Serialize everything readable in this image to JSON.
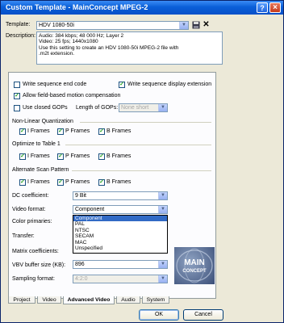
{
  "window": {
    "title": "Custom Template - MainConcept MPEG-2",
    "help": "?",
    "close": "×"
  },
  "template": {
    "label": "Template:",
    "value": "HDV 1080-50i",
    "save_icon": "floppy-disk-icon",
    "delete_icon": "delete-x-icon"
  },
  "description": {
    "label": "Description:",
    "lines": [
      "Audio: 384 kbps; 48 000 Hz; Layer 2",
      "Video: 25 fps; 1440x1080",
      "Use this setting to create an HDV 1080-50i MPEG-2 file with",
      ".m2t extension."
    ]
  },
  "options": {
    "write_seq_end": {
      "label": "Write sequence end code",
      "checked": false
    },
    "write_seq_disp": {
      "label": "Write sequence display extension",
      "checked": true
    },
    "allow_field": {
      "label": "Allow field-based motion compensation",
      "checked": true
    },
    "closed_gops": {
      "label": "Use closed GOPs",
      "checked": false
    },
    "gop_length": {
      "label": "Length of GOPs:",
      "value": "None short"
    }
  },
  "nonlinear": {
    "title": "Non-Linear Quantization",
    "i": "I Frames",
    "p": "P Frames",
    "b": "B Frames"
  },
  "optimize": {
    "title": "Optimize to Table 1",
    "i": "I Frames",
    "p": "P Frames",
    "b": "B Frames"
  },
  "altscan": {
    "title": "Alternate Scan Pattern",
    "i": "I Frames",
    "p": "P Frames",
    "b": "B Frames"
  },
  "fields": {
    "dc": {
      "label": "DC coefficient:",
      "value": "9 Bit"
    },
    "video_format": {
      "label": "Video format:",
      "value": "Component"
    },
    "color_primaries": {
      "label": "Color primaries:"
    },
    "transfer": {
      "label": "Transfer:"
    },
    "matrix": {
      "label": "Matrix coefficients:"
    },
    "vbv": {
      "label": "VBV buffer size (KB):",
      "value": "896"
    },
    "sampling": {
      "label": "Sampling format:",
      "value": "4:2:0"
    }
  },
  "dropdown_options": [
    "Component",
    "PAL",
    "NTSC",
    "SECAM",
    "MAC",
    "Unspecified"
  ],
  "logo": {
    "line1": "MAIN",
    "line2": "CONCEPT"
  },
  "tabs": [
    "Project",
    "Video",
    "Advanced Video",
    "Audio",
    "System"
  ],
  "buttons": {
    "ok": "OK",
    "cancel": "Cancel"
  }
}
